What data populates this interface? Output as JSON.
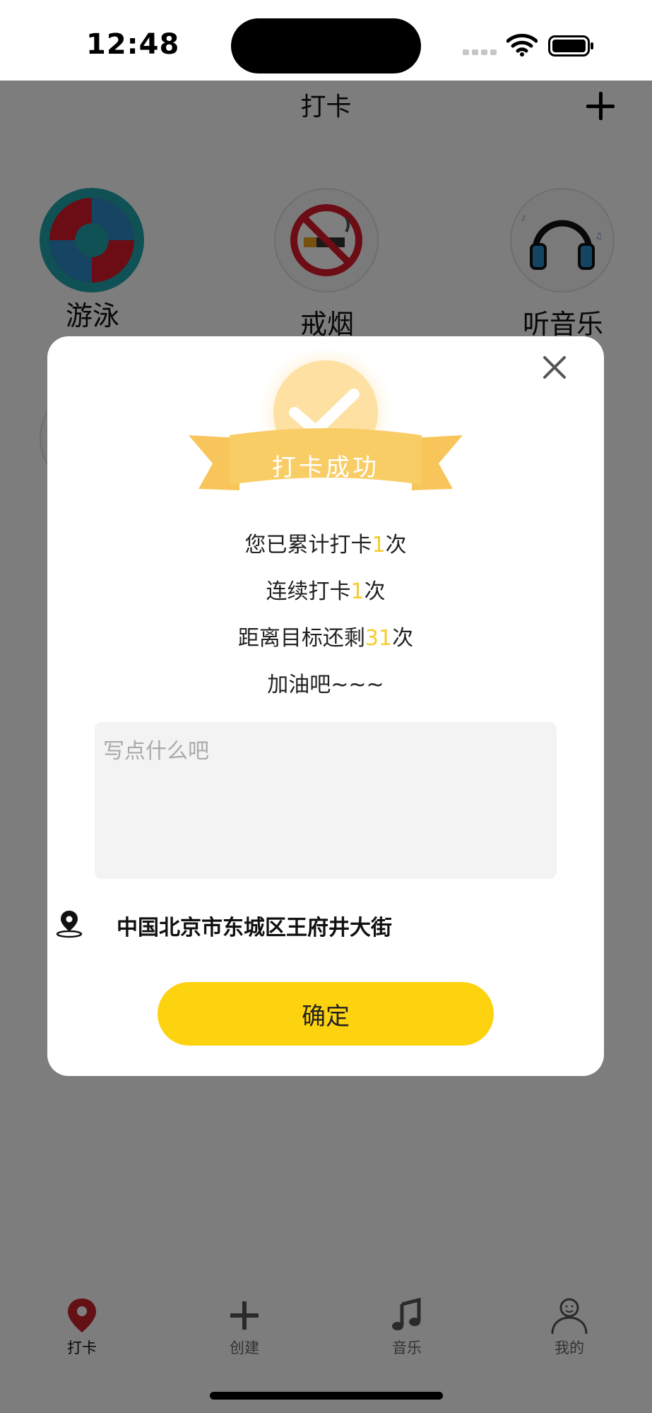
{
  "status_bar": {
    "time": "12:48"
  },
  "nav": {
    "title": "打卡"
  },
  "habits": [
    {
      "label": "游泳",
      "icon": "lifebuoy-icon"
    },
    {
      "label": "戒烟",
      "icon": "no-smoking-icon"
    },
    {
      "label": "听音乐",
      "icon": "headphones-icon"
    }
  ],
  "dialog": {
    "badge_text": "打卡成功",
    "total_prefix": "您已累计打卡",
    "total_count": "1",
    "total_suffix": "次",
    "streak_prefix": "连续打卡",
    "streak_count": "1",
    "streak_suffix": "次",
    "remaining_prefix": "距离目标还剩",
    "remaining_count": "31",
    "remaining_suffix": "次",
    "encourage": "加油吧~~~",
    "note_placeholder": "写点什么吧",
    "location": "中国北京市东城区王府井大街",
    "confirm_label": "确定"
  },
  "tabs": [
    {
      "label": "打卡",
      "icon": "location-pin-icon",
      "active": true
    },
    {
      "label": "创建",
      "icon": "plus-icon",
      "active": false
    },
    {
      "label": "音乐",
      "icon": "music-note-icon",
      "active": false
    },
    {
      "label": "我的",
      "icon": "user-icon",
      "active": false
    }
  ],
  "colors": {
    "accent_yellow": "#fdd20f",
    "highlight": "#f5cc2c",
    "badge_orange": "#f7c04a",
    "overlay": "rgba(0,0,0,0.5)"
  }
}
